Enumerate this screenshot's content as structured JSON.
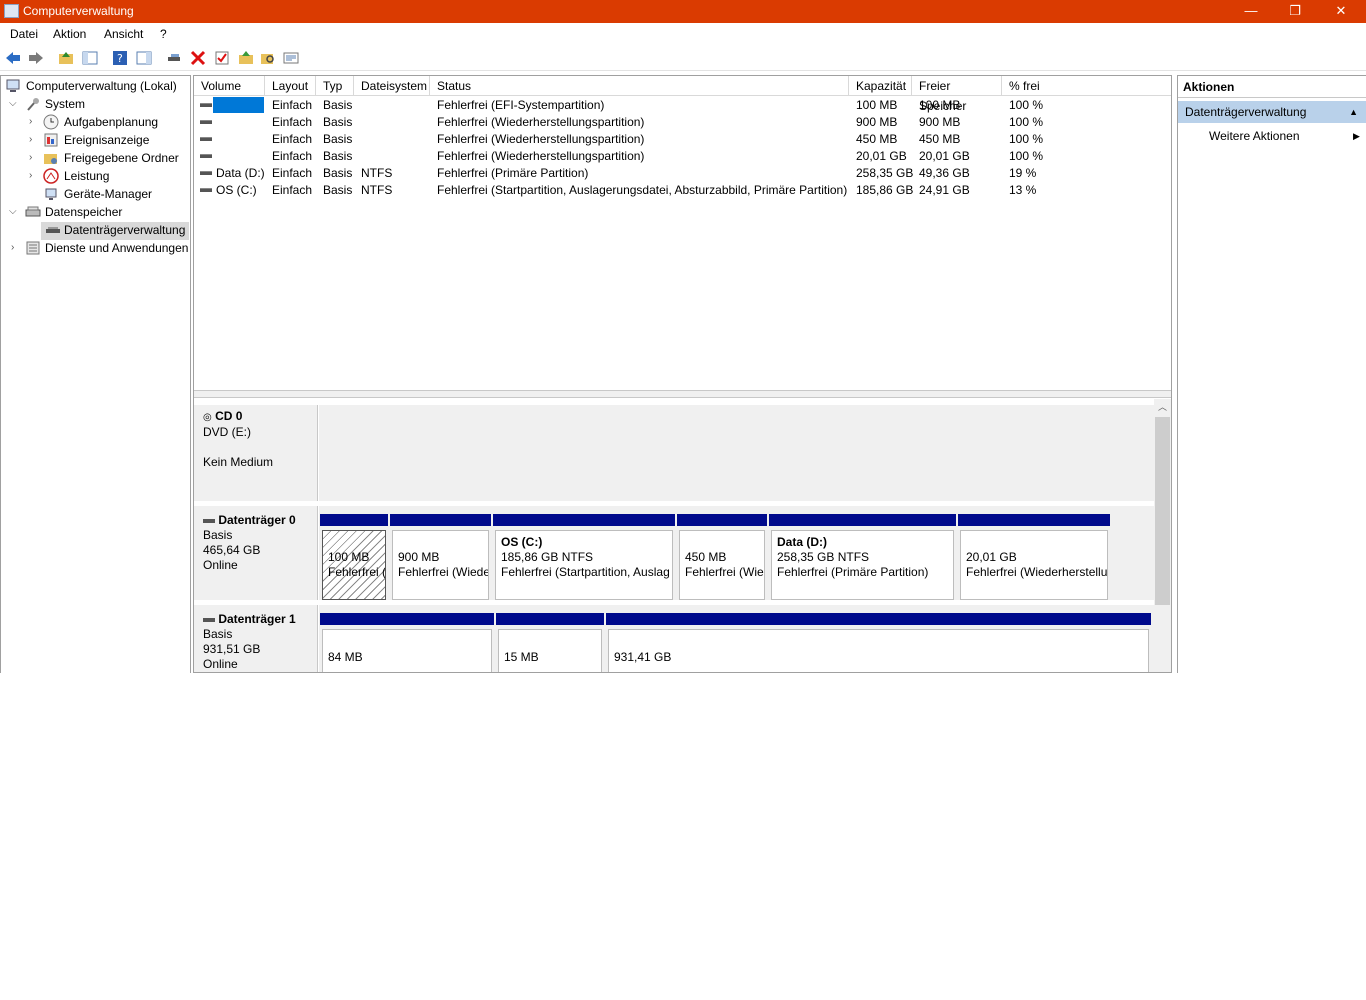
{
  "window": {
    "title": "Computerverwaltung",
    "minimize": "—",
    "restore": "❐",
    "close": "✕"
  },
  "menu": [
    "Datei",
    "Aktion",
    "Ansicht",
    "?"
  ],
  "tree": {
    "root": "Computerverwaltung (Lokal)",
    "system": "System",
    "aufgaben": "Aufgabenplanung",
    "ereignis": "Ereignisanzeige",
    "freigegeben": "Freigegebene Ordner",
    "leistung": "Leistung",
    "geraete": "Geräte-Manager",
    "datenspeicher": "Datenspeicher",
    "datentraeger": "Datenträgerverwaltung",
    "dienste": "Dienste und Anwendungen"
  },
  "volumes": {
    "headers": [
      "Volume",
      "Layout",
      "Typ",
      "Dateisystem",
      "Status",
      "Kapazität",
      "Freier Speicher",
      "% frei"
    ],
    "rows": [
      [
        "",
        "Einfach",
        "Basis",
        "",
        "Fehlerfrei (EFI-Systempartition)",
        "100 MB",
        "100 MB",
        "100 %"
      ],
      [
        "",
        "Einfach",
        "Basis",
        "",
        "Fehlerfrei (Wiederherstellungspartition)",
        "900 MB",
        "900 MB",
        "100 %"
      ],
      [
        "",
        "Einfach",
        "Basis",
        "",
        "Fehlerfrei (Wiederherstellungspartition)",
        "450 MB",
        "450 MB",
        "100 %"
      ],
      [
        "",
        "Einfach",
        "Basis",
        "",
        "Fehlerfrei (Wiederherstellungspartition)",
        "20,01 GB",
        "20,01 GB",
        "100 %"
      ],
      [
        "Data (D:)",
        "Einfach",
        "Basis",
        "NTFS",
        "Fehlerfrei (Primäre Partition)",
        "258,35 GB",
        "49,36 GB",
        "19 %"
      ],
      [
        "OS (C:)",
        "Einfach",
        "Basis",
        "NTFS",
        "Fehlerfrei (Startpartition, Auslagerungsdatei, Absturzabbild, Primäre Partition)",
        "185,86 GB",
        "24,91 GB",
        "13 %"
      ]
    ]
  },
  "disks": {
    "cd0": {
      "name": "CD 0",
      "line1": "DVD (E:)",
      "line2": "Kein Medium"
    },
    "d0": {
      "name": "Datenträger 0",
      "type": "Basis",
      "size": "465,64 GB",
      "status": "Online",
      "parts": [
        {
          "l1": "",
          "l2": "100 MB",
          "l3": "Fehlerfrei ("
        },
        {
          "l1": "",
          "l2": "900 MB",
          "l3": "Fehlerfrei (Wiede"
        },
        {
          "l1": "OS  (C:)",
          "l2": "185,86 GB NTFS",
          "l3": "Fehlerfrei (Startpartition, Auslag"
        },
        {
          "l1": "",
          "l2": "450 MB",
          "l3": "Fehlerfrei (Wie"
        },
        {
          "l1": "Data  (D:)",
          "l2": "258,35 GB NTFS",
          "l3": "Fehlerfrei (Primäre Partition)"
        },
        {
          "l1": "",
          "l2": "20,01 GB",
          "l3": "Fehlerfrei (Wiederherstellu"
        }
      ]
    },
    "d1": {
      "name": "Datenträger 1",
      "type": "Basis",
      "size": "931,51 GB",
      "status": "Online",
      "parts": [
        {
          "l2": "84 MB"
        },
        {
          "l2": "15 MB"
        },
        {
          "l2": "931,41 GB"
        }
      ]
    }
  },
  "actions": {
    "header": "Aktionen",
    "section": "Datenträgerverwaltung",
    "item": "Weitere Aktionen"
  },
  "colors": {
    "titlebar": "#da3b01",
    "partition_bar": "#000a8c",
    "selection": "#0078d7",
    "actions_section": "#b9d1ea"
  }
}
